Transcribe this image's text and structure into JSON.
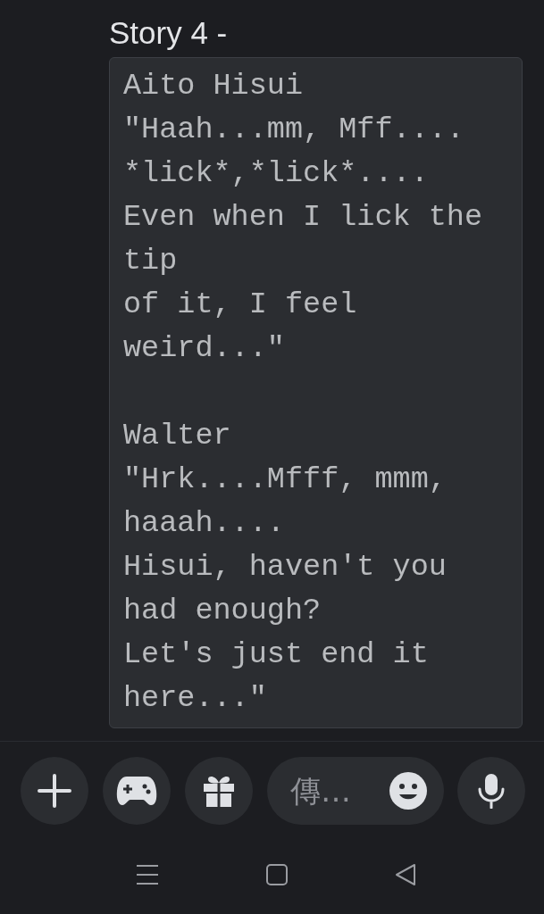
{
  "message": {
    "title": "Story 4 -",
    "code_block": {
      "text": "Aito Hisui\n\"Haah...mm, Mff....\n*lick*,*lick*....\nEven when I lick the\ntip\nof it, I feel\nweird...\"\n\nWalter\n\"Hrk....Mfff, mmm,\nhaaah....\nHisui, haven't you\nhad enough?\nLet's just end it\nhere...\""
    }
  },
  "composer": {
    "placeholder": "傳…"
  }
}
